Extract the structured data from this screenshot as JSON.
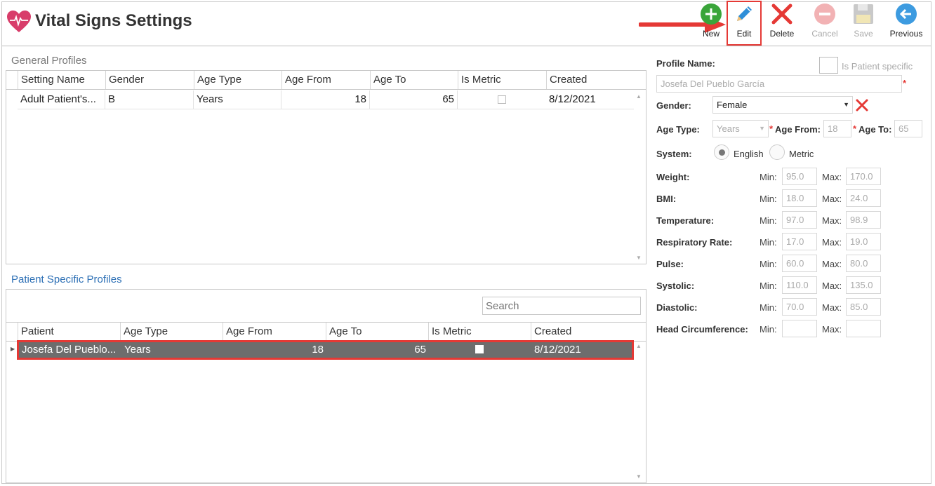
{
  "header": {
    "title": "Vital Signs Settings",
    "toolbar": {
      "new": "New",
      "edit": "Edit",
      "delete": "Delete",
      "cancel": "Cancel",
      "save": "Save",
      "previous": "Previous"
    }
  },
  "general_profiles": {
    "title": "General Profiles",
    "columns": [
      "Setting Name",
      "Gender",
      "Age Type",
      "Age From",
      "Age To",
      "Is Metric",
      "Created"
    ],
    "rows": [
      {
        "setting_name": "Adult Patient's...",
        "gender": "B",
        "age_type": "Years",
        "age_from": "18",
        "age_to": "65",
        "is_metric": false,
        "created": "8/12/2021"
      }
    ]
  },
  "patient_profiles": {
    "title": "Patient Specific Profiles",
    "search_placeholder": "Search",
    "columns": [
      "Patient",
      "Age Type",
      "Age From",
      "Age To",
      "Is Metric",
      "Created"
    ],
    "rows": [
      {
        "patient": "Josefa Del Pueblo...",
        "age_type": "Years",
        "age_from": "18",
        "age_to": "65",
        "is_metric": false,
        "created": "8/12/2021",
        "selected": true
      }
    ]
  },
  "form": {
    "profile_name_label": "Profile Name:",
    "is_patient_specific_label": "Is Patient specific",
    "profile_name_value": "Josefa Del Pueblo García",
    "gender_label": "Gender:",
    "gender_value": "Female",
    "age_type_label": "Age Type:",
    "age_type_value": "Years",
    "age_from_label": "Age From:",
    "age_from_value": "18",
    "age_to_label": "Age To:",
    "age_to_value": "65",
    "system_label": "System:",
    "system_english": "English",
    "system_metric": "Metric",
    "min_label": "Min:",
    "max_label": "Max:",
    "vitals": [
      {
        "label": "Weight:",
        "min": "95.0",
        "max": "170.0"
      },
      {
        "label": "BMI:",
        "min": "18.0",
        "max": "24.0"
      },
      {
        "label": "Temperature:",
        "min": "97.0",
        "max": "98.9"
      },
      {
        "label": "Respiratory Rate:",
        "min": "17.0",
        "max": "19.0"
      },
      {
        "label": "Pulse:",
        "min": "60.0",
        "max": "80.0"
      },
      {
        "label": "Systolic:",
        "min": "110.0",
        "max": "135.0"
      },
      {
        "label": "Diastolic:",
        "min": "70.0",
        "max": "85.0"
      },
      {
        "label": "Head Circumference:",
        "min": "",
        "max": ""
      }
    ]
  },
  "colors": {
    "accent_red": "#e53935",
    "new_green": "#3aa53a",
    "previous_blue": "#3d9be0",
    "heart": "#d83d6a"
  }
}
